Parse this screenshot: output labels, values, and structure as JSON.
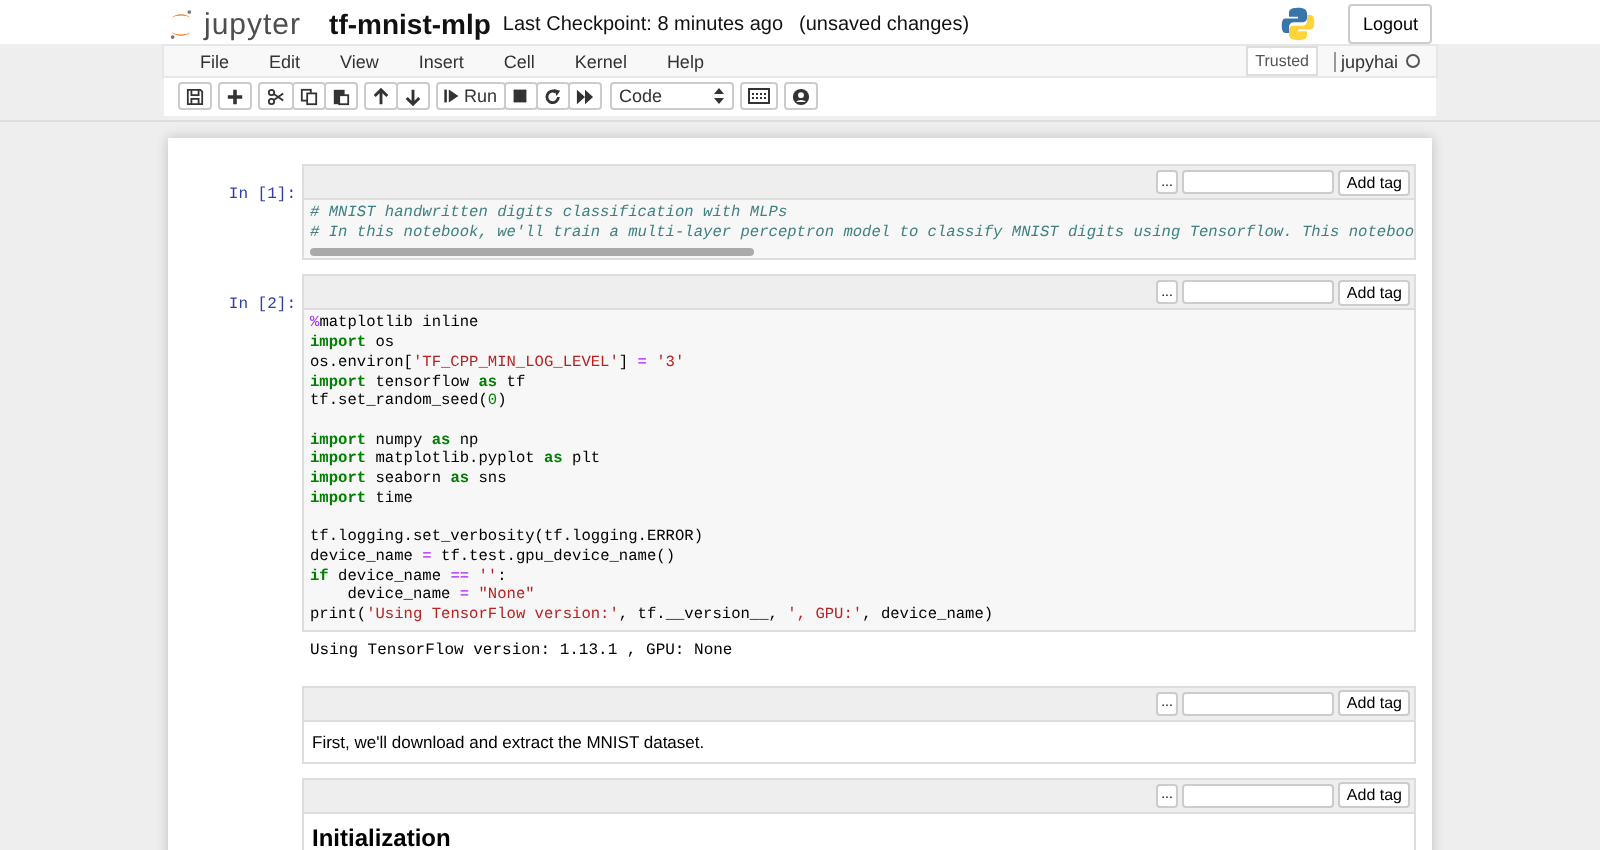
{
  "header": {
    "logo_text": "jupyter",
    "notebook_name": "tf-mnist-mlp",
    "checkpoint": "Last Checkpoint: 8 minutes ago",
    "save_status": "(unsaved changes)",
    "logout": "Logout"
  },
  "menu": {
    "items": [
      "File",
      "Edit",
      "View",
      "Insert",
      "Cell",
      "Kernel",
      "Help"
    ],
    "trusted": "Trusted",
    "kernel_name": "jupyhai",
    "kernel_busy": false
  },
  "toolbar": {
    "run_label": "Run",
    "cell_type": "Code"
  },
  "cells": [
    {
      "kind": "code",
      "prompt": "In [1]:",
      "more": "...",
      "add_tag": "Add tag",
      "scrollbar": true,
      "blocks": [
        [
          [
            {
              "t": "# MNIST handwritten digits classification with MLPs",
              "kind": "comment"
            }
          ],
          [
            {
              "t": "# In this notebook, we'll train a multi-layer perceptron model to classify MNIST digits using Tensorflow. This noteboo",
              "kind": "comment"
            }
          ]
        ]
      ]
    },
    {
      "kind": "code",
      "prompt": "In [2]:",
      "more": "...",
      "add_tag": "Add tag",
      "scrollbar": false,
      "blocks": [
        [
          [
            {
              "t": "%",
              "kind": "magic"
            },
            {
              "t": "matplotlib inline",
              "kind": "plain"
            }
          ],
          [
            {
              "t": "import",
              "kind": "kw"
            },
            {
              "t": " os",
              "kind": "plain"
            }
          ],
          [
            {
              "t": "os.environ[",
              "kind": "plain"
            },
            {
              "t": "'TF_CPP_MIN_LOG_LEVEL'",
              "kind": "str"
            },
            {
              "t": "] ",
              "kind": "plain"
            },
            {
              "t": "=",
              "kind": "op"
            },
            {
              "t": " '3'",
              "kind": "str"
            }
          ],
          [
            {
              "t": "import",
              "kind": "kw"
            },
            {
              "t": " tensorflow ",
              "kind": "plain"
            },
            {
              "t": "as",
              "kind": "kw"
            },
            {
              "t": " tf",
              "kind": "plain"
            }
          ],
          [
            {
              "t": "tf.set_random_seed(",
              "kind": "plain"
            },
            {
              "t": "0",
              "kind": "num"
            },
            {
              "t": ")",
              "kind": "plain"
            }
          ]
        ],
        [
          [
            {
              "t": "import",
              "kind": "kw"
            },
            {
              "t": " numpy ",
              "kind": "plain"
            },
            {
              "t": "as",
              "kind": "kw"
            },
            {
              "t": " np",
              "kind": "plain"
            }
          ],
          [
            {
              "t": "import",
              "kind": "kw"
            },
            {
              "t": " matplotlib.pyplot ",
              "kind": "plain"
            },
            {
              "t": "as",
              "kind": "kw"
            },
            {
              "t": " plt",
              "kind": "plain"
            }
          ],
          [
            {
              "t": "import",
              "kind": "kw"
            },
            {
              "t": " seaborn ",
              "kind": "plain"
            },
            {
              "t": "as",
              "kind": "kw"
            },
            {
              "t": " sns",
              "kind": "plain"
            }
          ],
          [
            {
              "t": "import",
              "kind": "kw"
            },
            {
              "t": " time",
              "kind": "plain"
            }
          ]
        ],
        [
          [
            {
              "t": "tf.logging.set_verbosity(tf.logging.ERROR)",
              "kind": "plain"
            }
          ],
          [
            {
              "t": "device_name ",
              "kind": "plain"
            },
            {
              "t": "=",
              "kind": "op"
            },
            {
              "t": " tf.test.gpu_device_name()",
              "kind": "plain"
            }
          ],
          [
            {
              "t": "if",
              "kind": "kw"
            },
            {
              "t": " device_name ",
              "kind": "plain"
            },
            {
              "t": "==",
              "kind": "op"
            },
            {
              "t": " ''",
              "kind": "str"
            },
            {
              "t": ":",
              "kind": "plain"
            }
          ],
          [
            {
              "t": "    device_name ",
              "kind": "plain"
            },
            {
              "t": "=",
              "kind": "op"
            },
            {
              "t": " \"None\"",
              "kind": "str"
            }
          ],
          [
            {
              "t": "print(",
              "kind": "plain"
            },
            {
              "t": "'Using TensorFlow version:'",
              "kind": "str"
            },
            {
              "t": ", tf.__version__, ",
              "kind": "plain"
            },
            {
              "t": "', GPU:'",
              "kind": "str"
            },
            {
              "t": ", device_name)",
              "kind": "plain"
            }
          ]
        ]
      ],
      "output": "Using TensorFlow version: 1.13.1 , GPU: None"
    },
    {
      "kind": "markdown",
      "more": "...",
      "add_tag": "Add tag",
      "text": "First, we'll download and extract the MNIST dataset."
    },
    {
      "kind": "heading",
      "more": "...",
      "add_tag": "Add tag",
      "text": "Initialization"
    }
  ]
}
